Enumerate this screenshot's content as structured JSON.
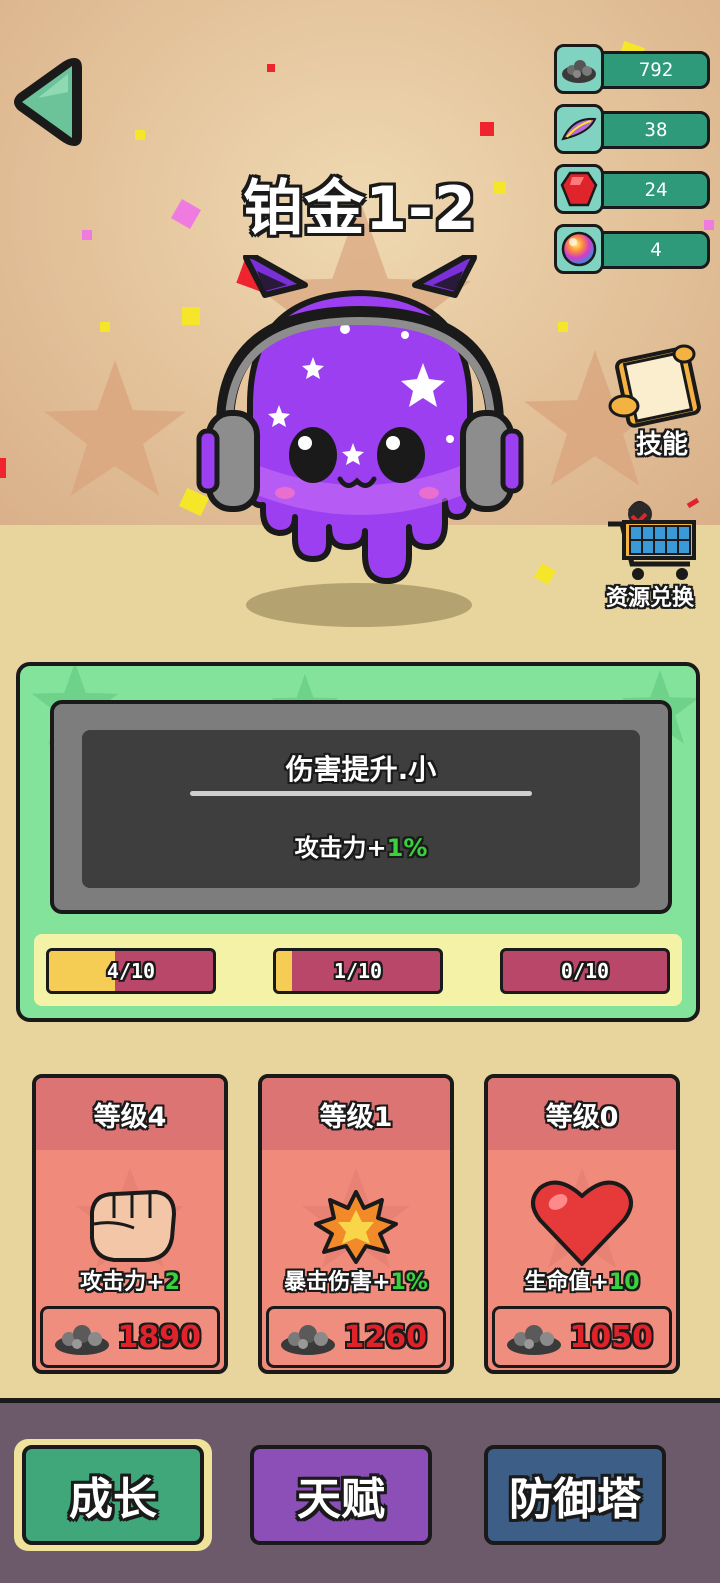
{
  "stage": {
    "title": "铂金1-2"
  },
  "resources": [
    {
      "icon": "ore-pile-icon",
      "value": "792"
    },
    {
      "icon": "feather-icon",
      "value": "38"
    },
    {
      "icon": "red-gem-icon",
      "value": "24"
    },
    {
      "icon": "rainbow-orb-icon",
      "value": "4"
    }
  ],
  "side_buttons": {
    "skills": "技能",
    "exchange": "资源兑换"
  },
  "skill_panel": {
    "name": "伤害提升.小",
    "effect_prefix": "攻击力+",
    "effect_value": "1%",
    "progress": [
      {
        "label": "4/10",
        "fraction": 0.4
      },
      {
        "label": "1/10",
        "fraction": 0.1
      },
      {
        "label": "0/10",
        "fraction": 0.0
      }
    ]
  },
  "cards": [
    {
      "level": "等级4",
      "icon": "fist-icon",
      "stat": "攻击力+",
      "bonus": "2",
      "cost": "1890"
    },
    {
      "level": "等级1",
      "icon": "explosion-icon",
      "stat": "暴击伤害+",
      "bonus": "1%",
      "cost": "1260"
    },
    {
      "level": "等级0",
      "icon": "heart-icon",
      "stat": "生命值+",
      "bonus": "10",
      "cost": "1050"
    }
  ],
  "nav": {
    "growth": "成长",
    "talent": "天赋",
    "tower": "防御塔"
  },
  "colors": {
    "accent_green": "#37d23d",
    "cost_red": "#e0222b",
    "nav_growth": "#3fa779",
    "nav_talent": "#8c4fb7",
    "nav_tower": "#3d5e86"
  }
}
